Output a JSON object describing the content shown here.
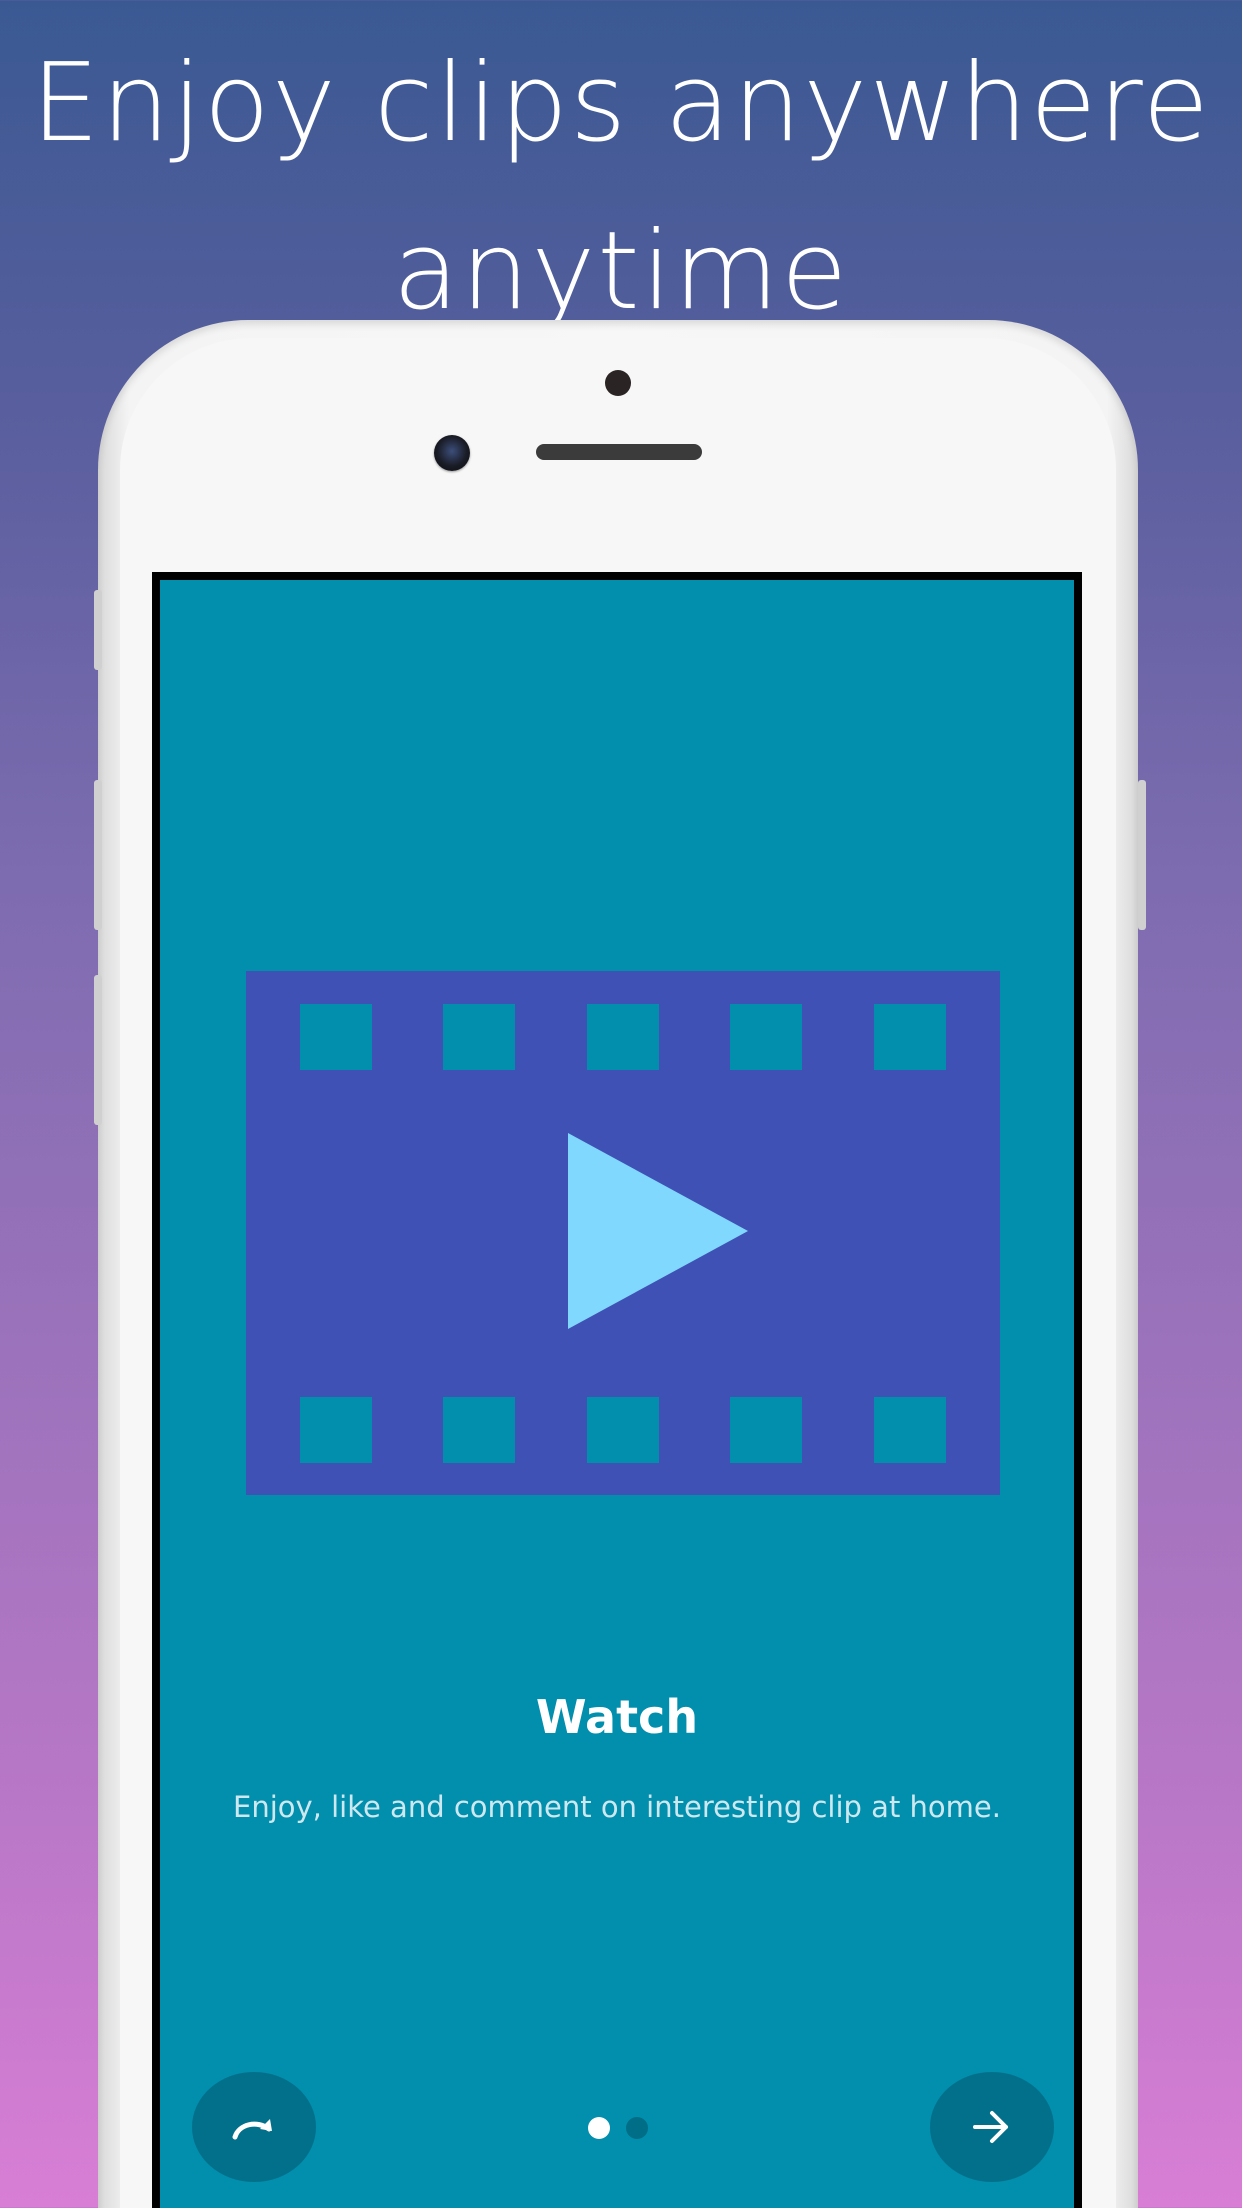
{
  "banner": {
    "line1": "Enjoy clips anywhere",
    "line2": "anytime"
  },
  "onboarding": {
    "illustration_icon": "video-film-play-icon",
    "title": "Watch",
    "description": "Enjoy, like and comment on interesting clip at home.",
    "pager": {
      "total": 2,
      "current": 1
    },
    "skip_icon": "skip-redo-arrow-icon",
    "next_icon": "arrow-right-icon"
  },
  "colors": {
    "screen_background": "#028ead",
    "film_strip": "#3f51b5",
    "play_triangle": "#80d8ff",
    "nav_button": "#02708b",
    "dot_active": "#ffffff",
    "dot_inactive": "#016e87"
  }
}
